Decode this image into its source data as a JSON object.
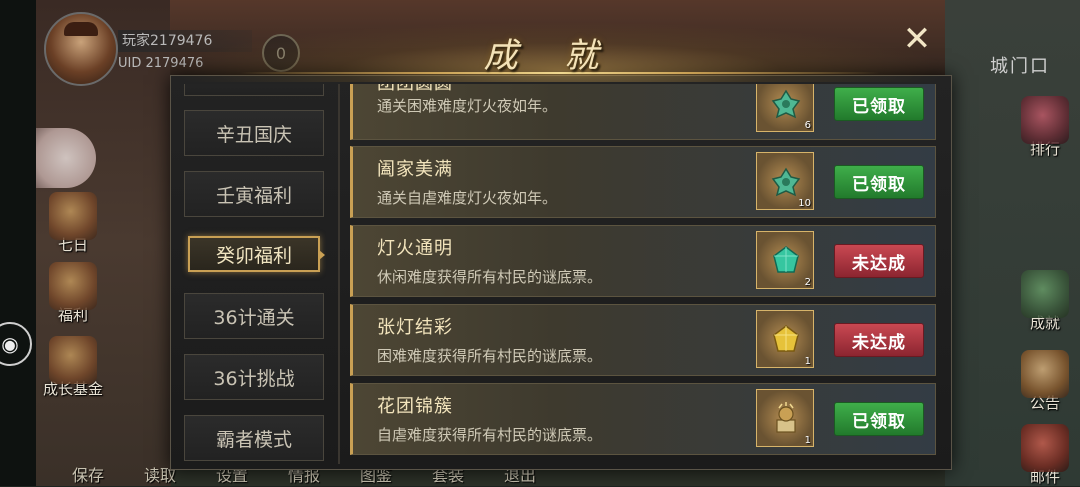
{
  "header": {
    "player_name": "玩家2179476",
    "uid": "UID  2179476",
    "badge_value": "0",
    "location": "城门口"
  },
  "left_menu": [
    {
      "label": "",
      "icon": "character-icon",
      "active": true
    },
    {
      "label": "七日",
      "icon": "seven-day-icon"
    },
    {
      "label": "福利",
      "icon": "welfare-icon"
    },
    {
      "label": "成长基金",
      "icon": "growth-fund-icon"
    }
  ],
  "right_menu": [
    {
      "label": "排行",
      "icon": "ranking-icon"
    },
    {
      "label": "成就",
      "icon": "achievement-icon"
    },
    {
      "label": "公告",
      "icon": "notice-icon"
    },
    {
      "label": "邮件",
      "icon": "mail-icon"
    }
  ],
  "bottom_menu": [
    "保存",
    "读取",
    "设置",
    "情报",
    "图鉴",
    "套装",
    "退出"
  ],
  "modal": {
    "title": "成 就",
    "close_symbol": "✕",
    "tabs": [
      "辛丑国庆",
      "壬寅福利",
      "癸卯福利",
      "36计通关",
      "36计挑战",
      "霸者模式"
    ],
    "active_tab": "癸卯福利",
    "achievements": [
      {
        "name": "团团圆圆",
        "desc": "通关困难难度灯火夜如年。",
        "reward_icon": "jade-icon",
        "reward_count": "6",
        "status": "已领取",
        "status_type": "claimed"
      },
      {
        "name": "阖家美满",
        "desc": "通关自虐难度灯火夜如年。",
        "reward_icon": "jade-icon",
        "reward_count": "10",
        "status": "已领取",
        "status_type": "claimed"
      },
      {
        "name": "灯火通明",
        "desc": "休闲难度获得所有村民的谜底票。",
        "reward_icon": "emerald-gem-icon",
        "reward_count": "2",
        "status": "未达成",
        "status_type": "unmet"
      },
      {
        "name": "张灯结彩",
        "desc": "困难难度获得所有村民的谜底票。",
        "reward_icon": "gold-gem-icon",
        "reward_count": "1",
        "status": "未达成",
        "status_type": "unmet"
      },
      {
        "name": "花团锦簇",
        "desc": "自虐难度获得所有村民的谜底票。",
        "reward_icon": "relic-icon",
        "reward_count": "1",
        "status": "已领取",
        "status_type": "claimed"
      }
    ]
  },
  "colors": {
    "accent_gold": "#c9a054",
    "claimed_green": "#2f9a3a",
    "unmet_red": "#b23a44"
  }
}
